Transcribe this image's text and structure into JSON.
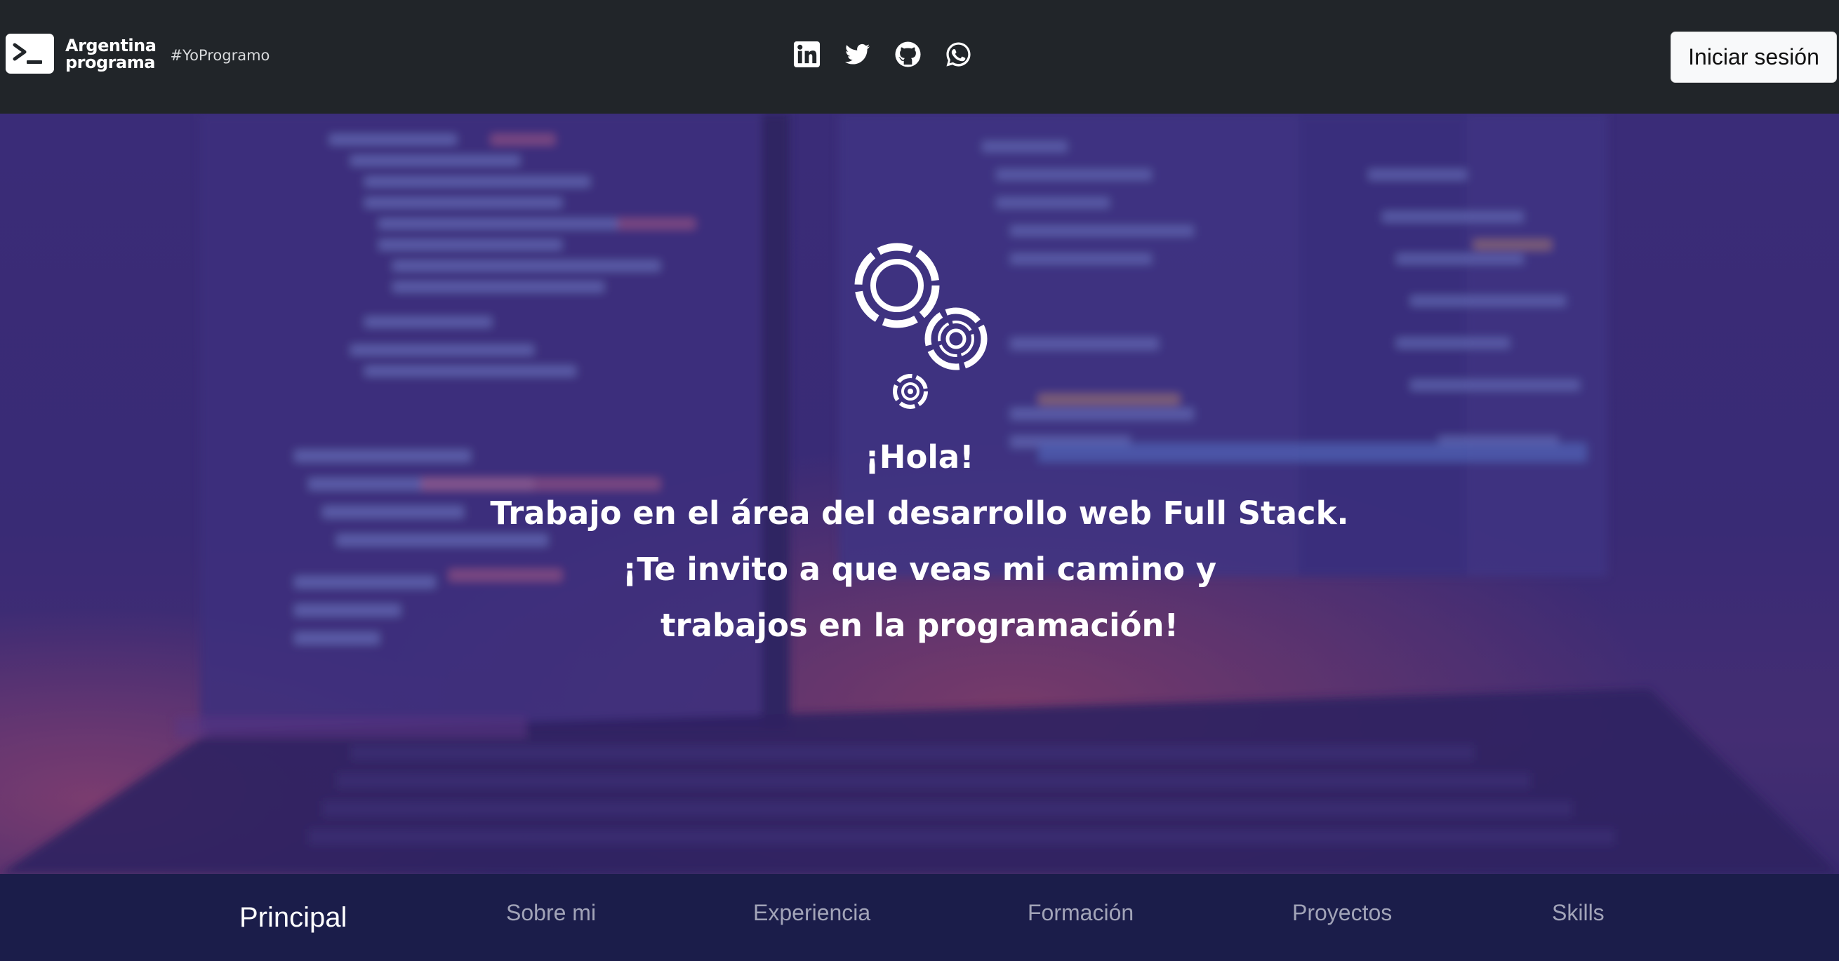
{
  "header": {
    "brand_line1": "Argentina",
    "brand_line2": "programa",
    "hashtag": "#YoProgramo",
    "socials": [
      "linkedin-icon",
      "twitter-icon",
      "github-icon",
      "whatsapp-icon"
    ],
    "login_label": "Iniciar sesión"
  },
  "hero": {
    "greeting": "¡Hola!",
    "line1": "Trabajo en el área del desarrollo web Full Stack.",
    "line2": "¡Te invito a que veas mi camino y",
    "line3": "trabajos en la programación!"
  },
  "nav": {
    "items": [
      {
        "label": "Principal",
        "active": true
      },
      {
        "label": "Sobre mi",
        "active": false
      },
      {
        "label": "Experiencia",
        "active": false
      },
      {
        "label": "Formación",
        "active": false
      },
      {
        "label": "Proyectos",
        "active": false
      },
      {
        "label": "Skills",
        "active": false
      }
    ]
  },
  "colors": {
    "header_bg": "#212529",
    "hero_overlay": "#3d2c7a",
    "nav_bg": "#1b1d4a",
    "nav_active": "#ffffff",
    "nav_inactive": "#a2a4b8"
  }
}
